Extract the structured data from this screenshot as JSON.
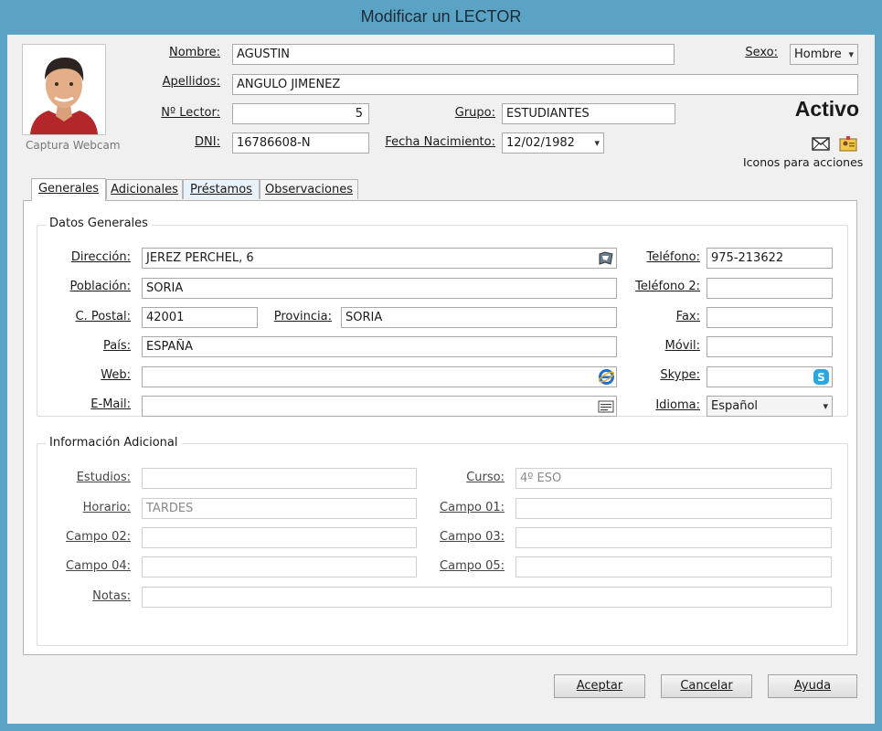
{
  "window": {
    "title": "Modificar un LECTOR"
  },
  "photo": {
    "caption": "Captura Webcam"
  },
  "header": {
    "nombre_label": "Nombre:",
    "nombre_value": "AGUSTIN",
    "apellidos_label": "Apellidos:",
    "apellidos_value": "ANGULO JIMENEZ",
    "lector_label": "Nº Lector:",
    "lector_value": "5",
    "grupo_label": "Grupo:",
    "grupo_value": "ESTUDIANTES",
    "dni_label": "DNI:",
    "dni_value": "16786608-N",
    "fecha_label": "Fecha Nacimiento:",
    "fecha_value": "12/02/1982",
    "sexo_label": "Sexo:",
    "sexo_value": "Hombre",
    "status": "Activo",
    "icons_caption": "Iconos para acciones"
  },
  "tabs": [
    {
      "label": "Generales"
    },
    {
      "label": "Adicionales"
    },
    {
      "label": "Préstamos"
    },
    {
      "label": "Observaciones"
    }
  ],
  "datos_generales": {
    "title": "Datos Generales",
    "direccion_label": "Dirección:",
    "direccion_value": "JEREZ PERCHEL, 6",
    "poblacion_label": "Población:",
    "poblacion_value": "SORIA",
    "cpostal_label": "C. Postal:",
    "cpostal_value": "42001",
    "provincia_label": "Provincia:",
    "provincia_value": "SORIA",
    "pais_label": "País:",
    "pais_value": "ESPAÑA",
    "web_label": "Web:",
    "web_value": "",
    "email_label": "E-Mail:",
    "email_value": "",
    "telefono_label": "Teléfono:",
    "telefono_value": "975-213622",
    "telefono2_label": "Teléfono 2:",
    "telefono2_value": "",
    "fax_label": "Fax:",
    "fax_value": "",
    "movil_label": "Móvil:",
    "movil_value": "",
    "skype_label": "Skype:",
    "skype_value": "",
    "idioma_label": "Idioma:",
    "idioma_value": "Español"
  },
  "info_adicional": {
    "title": "Información Adicional",
    "estudios_label": "Estudios:",
    "estudios_value": "",
    "horario_label": "Horario:",
    "horario_value": "TARDES",
    "campo02_label": "Campo 02:",
    "campo02_value": "",
    "campo04_label": "Campo 04:",
    "campo04_value": "",
    "notas_label": "Notas:",
    "notas_value": "",
    "curso_label": "Curso:",
    "curso_value": "4º ESO",
    "campo01_label": "Campo 01:",
    "campo01_value": "",
    "campo03_label": "Campo 03:",
    "campo03_value": "",
    "campo05_label": "Campo 05:",
    "campo05_value": ""
  },
  "buttons": {
    "aceptar": "Aceptar",
    "cancelar": "Cancelar",
    "ayuda": "Ayuda"
  },
  "colors": {
    "titlebar": "#5aa3c4",
    "ie_blue": "#1f6fd1",
    "skype_blue": "#2aa6e0"
  }
}
